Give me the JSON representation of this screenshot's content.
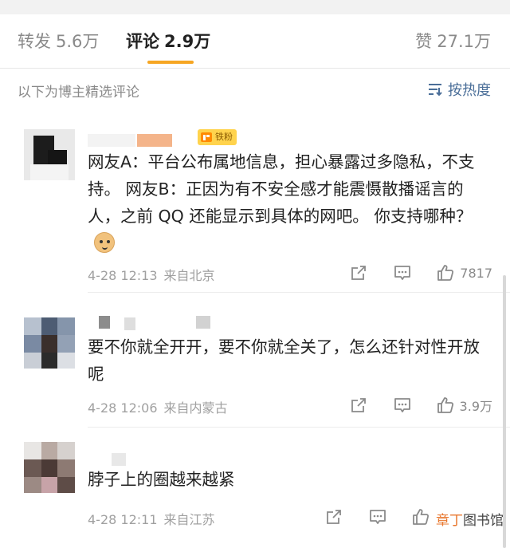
{
  "tabs": [
    {
      "label": "转发",
      "count": "5.6万"
    },
    {
      "label": "评论",
      "count": "2.9万"
    },
    {
      "label": "赞",
      "count": "27.1万"
    }
  ],
  "active_tab": 1,
  "filter": {
    "caption": "以下为博主精选评论",
    "sort_label": "按热度",
    "sort_icon": "sort-lines-icon"
  },
  "comments": [
    {
      "badge": "铁粉",
      "text": "网友A：平台公布属地信息，担心暴露过多隐私，不支持。 网友B：正因为有不安全感才能震慑散播谣言的人，之前 QQ 还能显示到具体的网吧。 你支持哪种？",
      "emoji": "doge-emoji",
      "time": "4-28 12:13",
      "location": "来自北京",
      "likes": "7817"
    },
    {
      "text": "要不你就全开开，要不你就全关了，怎么还针对性开放呢",
      "time": "4-28 12:06",
      "location": "来自内蒙古",
      "likes": "3.9万"
    },
    {
      "text": "脖子上的圈越来越紧",
      "time": "4-28 12:11",
      "location": "来自江苏",
      "likes": ""
    }
  ],
  "watermark": {
    "accent": "章丁",
    "rest": "图书馆"
  },
  "colors": {
    "accent": "#f6a623",
    "link": "#4a6e98",
    "muted": "#a0a0a0",
    "badge": "#ffd34d"
  }
}
